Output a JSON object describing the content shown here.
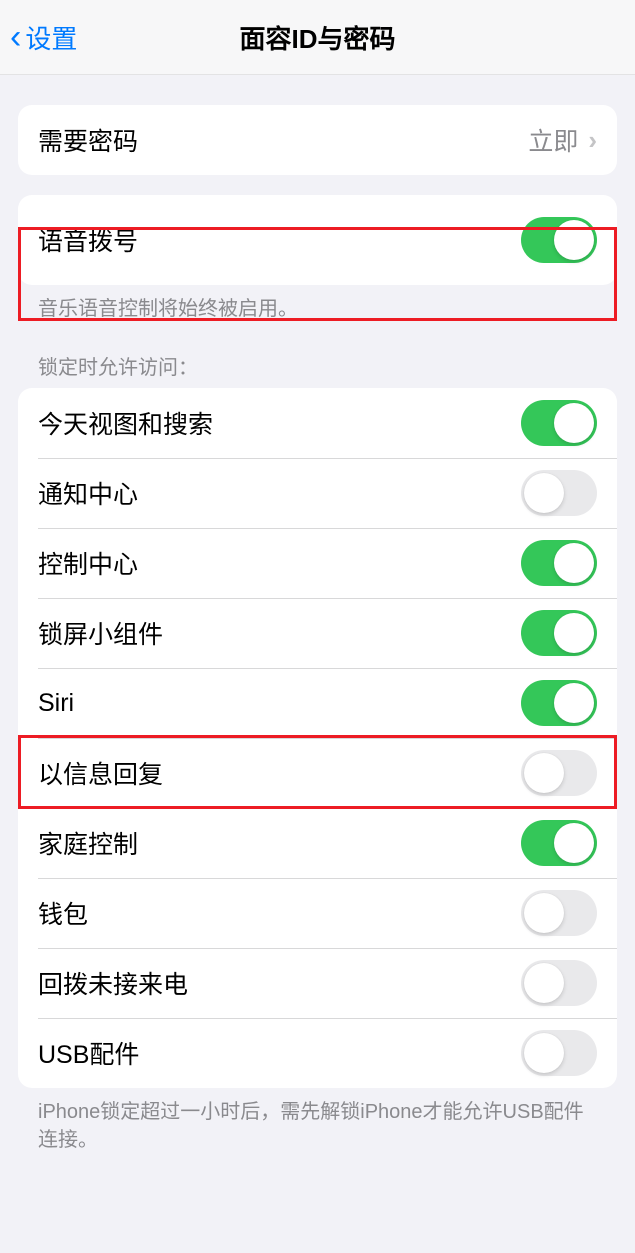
{
  "nav": {
    "back_label": "设置",
    "title": "面容ID与密码"
  },
  "require_passcode": {
    "label": "需要密码",
    "value": "立即"
  },
  "voice_dial": {
    "label": "语音拨号",
    "footer": "音乐语音控制将始终被启用。",
    "on": true
  },
  "locked_access": {
    "header": "锁定时允许访问：",
    "items": [
      {
        "label": "今天视图和搜索",
        "on": true
      },
      {
        "label": "通知中心",
        "on": false
      },
      {
        "label": "控制中心",
        "on": true
      },
      {
        "label": "锁屏小组件",
        "on": true
      },
      {
        "label": "Siri",
        "on": true
      },
      {
        "label": "以信息回复",
        "on": false
      },
      {
        "label": "家庭控制",
        "on": true
      },
      {
        "label": "钱包",
        "on": false
      },
      {
        "label": "回拨未接来电",
        "on": false
      },
      {
        "label": "USB配件",
        "on": false
      }
    ],
    "footer": "iPhone锁定超过一小时后，需先解锁iPhone才能允许USB配件连接。"
  }
}
